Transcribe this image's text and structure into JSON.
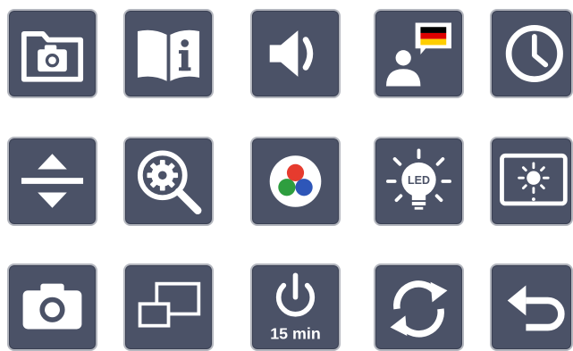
{
  "tiles": [
    {
      "id": "photo-folder",
      "icon": "folder-camera-icon"
    },
    {
      "id": "manual",
      "icon": "book-info-icon"
    },
    {
      "id": "volume",
      "icon": "speaker-icon"
    },
    {
      "id": "language",
      "icon": "person-speech-flag-icon",
      "flag_colors": [
        "#000000",
        "#dd0000",
        "#ffce00"
      ]
    },
    {
      "id": "clock",
      "icon": "clock-icon"
    },
    {
      "id": "scroll",
      "icon": "up-down-arrows-icon"
    },
    {
      "id": "zoom-settings",
      "icon": "magnifier-gear-icon"
    },
    {
      "id": "color-mode",
      "icon": "rgb-circles-icon",
      "colors": [
        "#e63b2e",
        "#2e9e3f",
        "#2e56b8"
      ]
    },
    {
      "id": "led",
      "icon": "led-bulb-icon",
      "label": "LED"
    },
    {
      "id": "screen-brightness",
      "icon": "monitor-brightness-icon"
    },
    {
      "id": "capture",
      "icon": "camera-icon"
    },
    {
      "id": "picture-in-picture",
      "icon": "overlapping-rectangles-icon"
    },
    {
      "id": "auto-off",
      "icon": "power-timer-icon",
      "label": "15 min"
    },
    {
      "id": "refresh",
      "icon": "refresh-arrows-icon"
    },
    {
      "id": "back",
      "icon": "return-arrow-icon"
    }
  ],
  "colors": {
    "tile_bg": "#4b5267",
    "tile_border": "#b3b6be",
    "icon": "#ffffff",
    "page_bg": "#ffffff"
  }
}
